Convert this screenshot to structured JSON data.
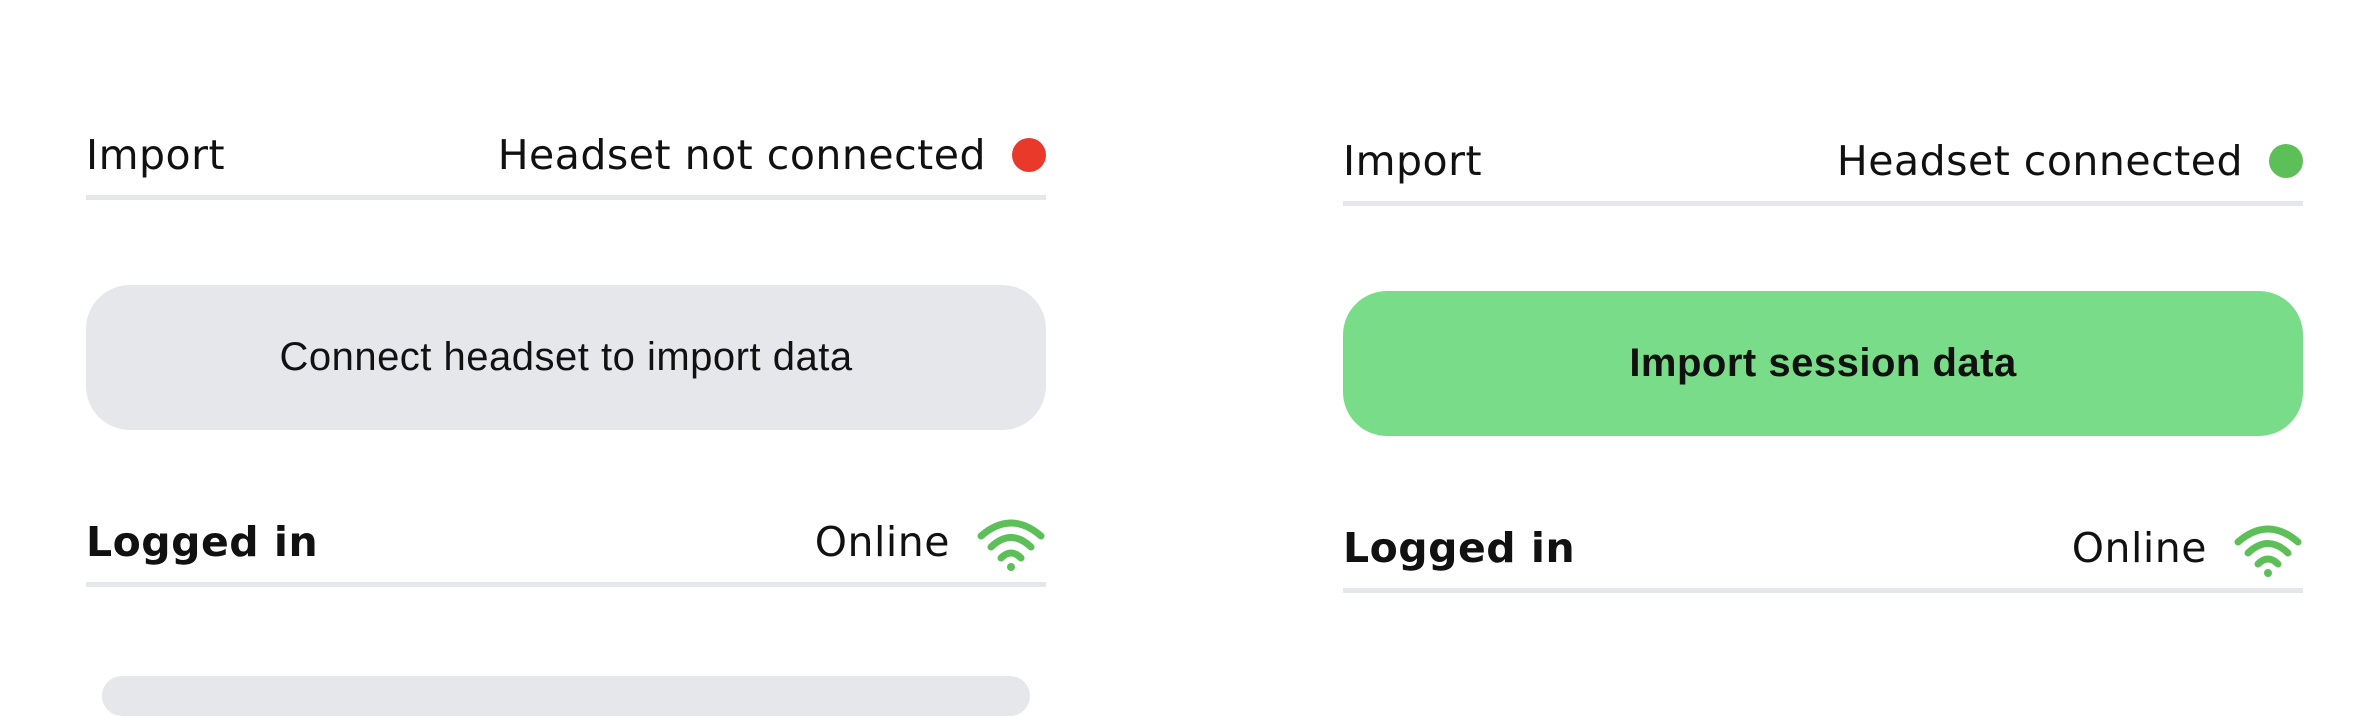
{
  "left_panel": {
    "import_label": "Import",
    "headset_status": "Headset not connected",
    "status_color": "#e8392b",
    "button_label": "Connect headset to import data",
    "logged_in_label": "Logged in",
    "online_status": "Online",
    "network_icon": "wifi-icon",
    "network_color": "#5dbf58"
  },
  "right_panel": {
    "import_label": "Import",
    "headset_status": "Headset connected",
    "status_color": "#5dbf58",
    "button_label": "Import session data",
    "button_color": "#78dc88",
    "logged_in_label": "Logged in",
    "online_status": "Online",
    "network_icon": "wifi-icon",
    "network_color": "#5dbf58"
  }
}
